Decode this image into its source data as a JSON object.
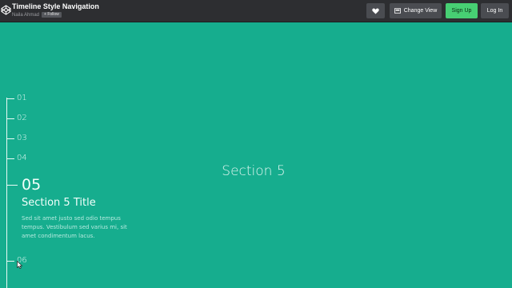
{
  "topbar": {
    "logo_icon": "codepen-logo-icon",
    "title": "Timeline Style Navigation",
    "author": "Naila Ahmad",
    "follow_label": "+ Follow",
    "heart_icon": "heart-icon",
    "change_view_label": "Change View",
    "change_view_icon": "layout-icon",
    "signup_label": "Sign Up",
    "login_label": "Log In"
  },
  "timeline": {
    "items": [
      {
        "num": "01"
      },
      {
        "num": "02"
      },
      {
        "num": "03"
      },
      {
        "num": "04"
      },
      {
        "num": "05"
      },
      {
        "num": "06"
      }
    ],
    "active": {
      "num": "05",
      "title": "Section 5 Title",
      "description": "Sed sit amet justo sed odio tempus tempus. Vestibulum sed varius mi, sit amet condimentum lacus."
    }
  },
  "main": {
    "heading": "Section 5"
  },
  "colors": {
    "background": "#16ad8e",
    "topbar": "#2d2e31",
    "signup": "#47cf73"
  }
}
